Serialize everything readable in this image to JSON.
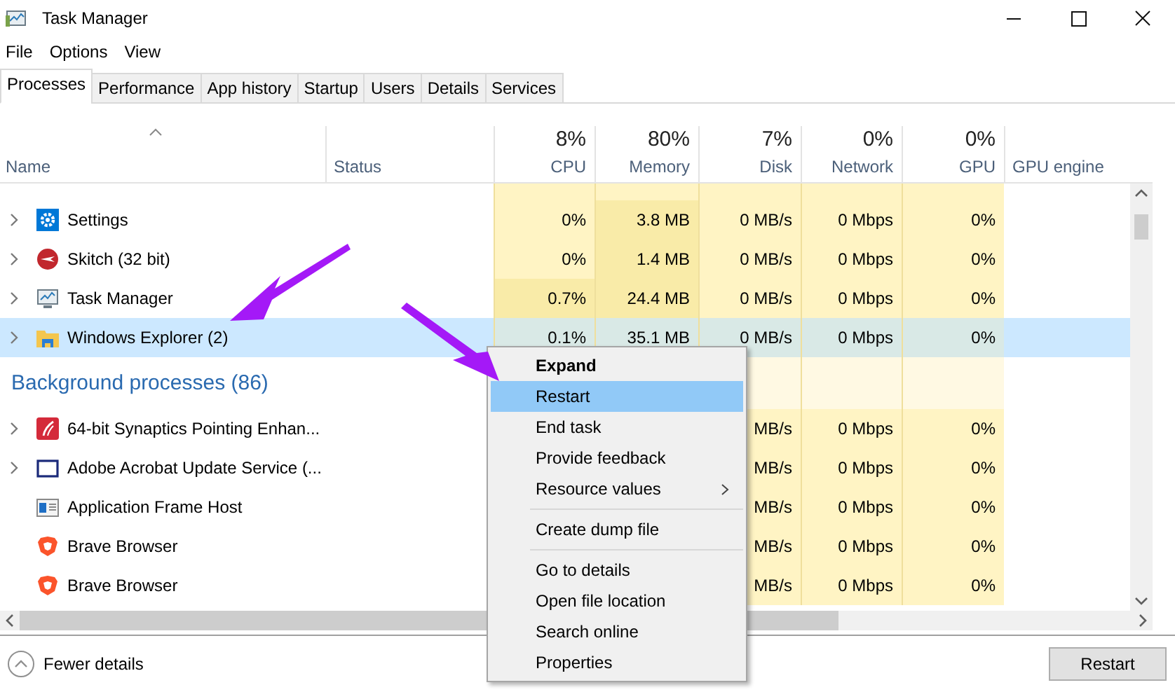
{
  "window": {
    "title": "Task Manager"
  },
  "menu": [
    "File",
    "Options",
    "View"
  ],
  "tabs": [
    {
      "label": "Processes",
      "selected": true
    },
    {
      "label": "Performance",
      "selected": false
    },
    {
      "label": "App history",
      "selected": false
    },
    {
      "label": "Startup",
      "selected": false
    },
    {
      "label": "Users",
      "selected": false
    },
    {
      "label": "Details",
      "selected": false
    },
    {
      "label": "Services",
      "selected": false
    }
  ],
  "columns": [
    {
      "label": "Name",
      "sorted": true
    },
    {
      "label": "Status",
      "sorted": false
    },
    {
      "label": "CPU",
      "total": "8%",
      "sorted": false
    },
    {
      "label": "Memory",
      "total": "80%",
      "sorted": false
    },
    {
      "label": "Disk",
      "total": "7%",
      "sorted": false
    },
    {
      "label": "Network",
      "total": "0%",
      "sorted": false
    },
    {
      "label": "GPU",
      "total": "0%",
      "sorted": false
    },
    {
      "label": "GPU engine",
      "sorted": false
    }
  ],
  "rows": [
    {
      "kind": "process",
      "name": "Settings",
      "expandable": true,
      "selected": false,
      "cpu": "0%",
      "memory": "3.8 MB",
      "disk": "0 MB/s",
      "network": "0 Mbps",
      "gpu": "0%"
    },
    {
      "kind": "process",
      "name": "Skitch (32 bit)",
      "expandable": true,
      "selected": false,
      "cpu": "0%",
      "memory": "1.4 MB",
      "disk": "0 MB/s",
      "network": "0 Mbps",
      "gpu": "0%"
    },
    {
      "kind": "process",
      "name": "Task Manager",
      "expandable": true,
      "selected": false,
      "cpu": "0.7%",
      "memory": "24.4 MB",
      "disk": "0 MB/s",
      "network": "0 Mbps",
      "gpu": "0%"
    },
    {
      "kind": "process",
      "name": "Windows Explorer (2)",
      "expandable": true,
      "selected": true,
      "cpu": "0.1%",
      "memory": "35.1 MB",
      "disk": "0 MB/s",
      "network": "0 Mbps",
      "gpu": "0%"
    },
    {
      "kind": "group",
      "title": "Background processes (86)"
    },
    {
      "kind": "process",
      "name": "64-bit Synaptics Pointing Enhan...",
      "expandable": true,
      "selected": false,
      "disk": "MB/s",
      "network": "0 Mbps",
      "gpu": "0%"
    },
    {
      "kind": "process",
      "name": "Adobe Acrobat Update Service (...",
      "expandable": true,
      "selected": false,
      "disk": "MB/s",
      "network": "0 Mbps",
      "gpu": "0%"
    },
    {
      "kind": "process",
      "name": "Application Frame Host",
      "expandable": false,
      "selected": false,
      "disk": "MB/s",
      "network": "0 Mbps",
      "gpu": "0%"
    },
    {
      "kind": "process",
      "name": "Brave Browser",
      "expandable": false,
      "selected": false,
      "disk": "MB/s",
      "network": "0 Mbps",
      "gpu": "0%"
    },
    {
      "kind": "process",
      "name": "Brave Browser",
      "expandable": false,
      "selected": false,
      "disk": "MB/s",
      "network": "0 Mbps",
      "gpu": "0%"
    }
  ],
  "context_menu": [
    {
      "kind": "item",
      "label": "Expand",
      "default": true,
      "selected": false,
      "submenu": false
    },
    {
      "kind": "item",
      "label": "Restart",
      "default": false,
      "selected": true,
      "submenu": false
    },
    {
      "kind": "item",
      "label": "End task",
      "default": false,
      "selected": false,
      "submenu": false
    },
    {
      "kind": "item",
      "label": "Provide feedback",
      "default": false,
      "selected": false,
      "submenu": false
    },
    {
      "kind": "item",
      "label": "Resource values",
      "default": false,
      "selected": false,
      "submenu": true
    },
    {
      "kind": "separator"
    },
    {
      "kind": "item",
      "label": "Create dump file",
      "default": false,
      "selected": false,
      "submenu": false
    },
    {
      "kind": "separator"
    },
    {
      "kind": "item",
      "label": "Go to details",
      "default": false,
      "selected": false,
      "submenu": false
    },
    {
      "kind": "item",
      "label": "Open file location",
      "default": false,
      "selected": false,
      "submenu": false
    },
    {
      "kind": "item",
      "label": "Search online",
      "default": false,
      "selected": false,
      "submenu": false
    },
    {
      "kind": "item",
      "label": "Properties",
      "default": false,
      "selected": false,
      "submenu": false
    }
  ],
  "footer": {
    "toggle": "Fewer details",
    "button": "Restart"
  }
}
